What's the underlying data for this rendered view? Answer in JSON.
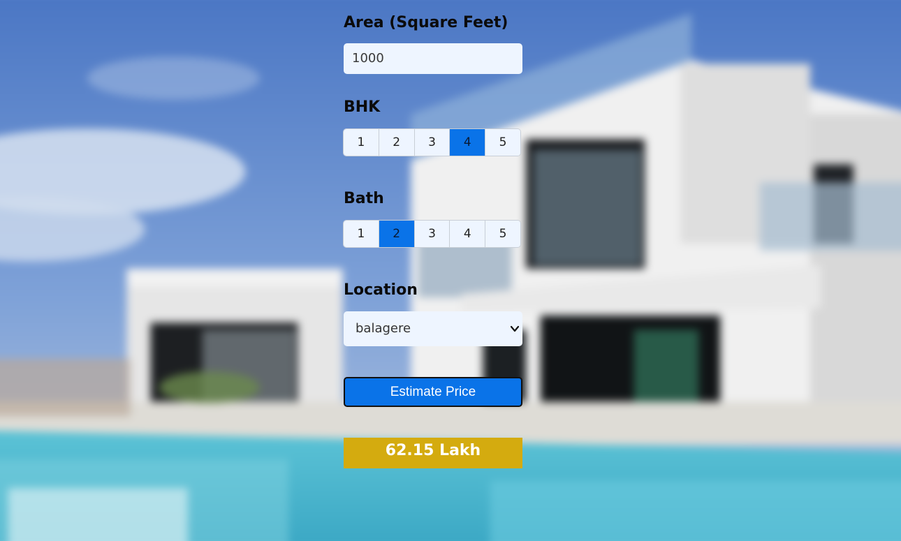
{
  "form": {
    "area": {
      "label": "Area (Square Feet)",
      "value": "1000"
    },
    "bhk": {
      "label": "BHK",
      "options": [
        "1",
        "2",
        "3",
        "4",
        "5"
      ],
      "selected": "4"
    },
    "bath": {
      "label": "Bath",
      "options": [
        "1",
        "2",
        "3",
        "4",
        "5"
      ],
      "selected": "2"
    },
    "location": {
      "label": "Location",
      "selected": "balagere"
    },
    "estimate_button_label": "Estimate Price",
    "result": "62.15 Lakh"
  },
  "colors": {
    "accent": "#0a73e8",
    "result_bg": "#d4ab0f",
    "field_bg": "#eef5ff"
  },
  "icons": {
    "dropdown": "chevron-down-icon"
  }
}
